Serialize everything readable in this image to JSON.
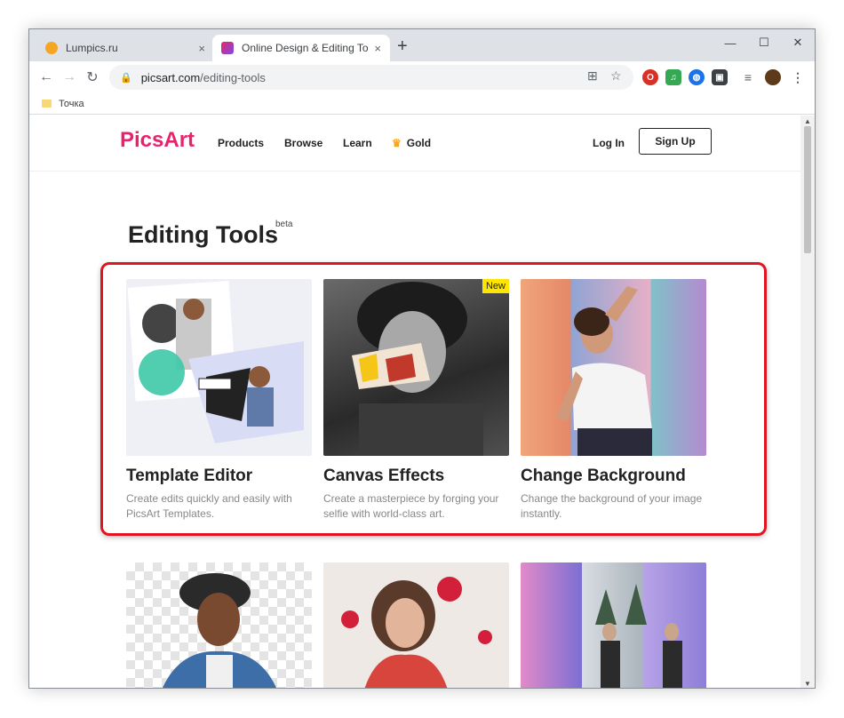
{
  "browser": {
    "tabs": [
      {
        "title": "Lumpics.ru",
        "close": "×"
      },
      {
        "title": "Online Design & Editing Tools fo",
        "close": "×"
      }
    ],
    "new_tab": "+",
    "window_controls": {
      "minimize": "—",
      "maximize": "☐",
      "close": "✕"
    },
    "address": {
      "domain": "picsart.com",
      "path": "/editing-tools"
    },
    "bookmark": "Точка"
  },
  "header": {
    "logo": "PicsArt",
    "nav": [
      "Products",
      "Browse",
      "Learn",
      "Gold"
    ],
    "login": "Log In",
    "signup": "Sign Up"
  },
  "main": {
    "title": "Editing Tools",
    "beta": "beta",
    "cards": [
      {
        "title": "Template Editor",
        "desc": "Create edits quickly and easily with PicsArt Templates."
      },
      {
        "title": "Canvas Effects",
        "desc": "Create a masterpiece by forging your selfie with world-class art.",
        "badge": "New"
      },
      {
        "title": "Change Background",
        "desc": "Change the background of your image instantly."
      }
    ]
  },
  "colors": {
    "brand": "#e8226d",
    "highlight": "#e0151f",
    "badge": "#ffe600"
  }
}
